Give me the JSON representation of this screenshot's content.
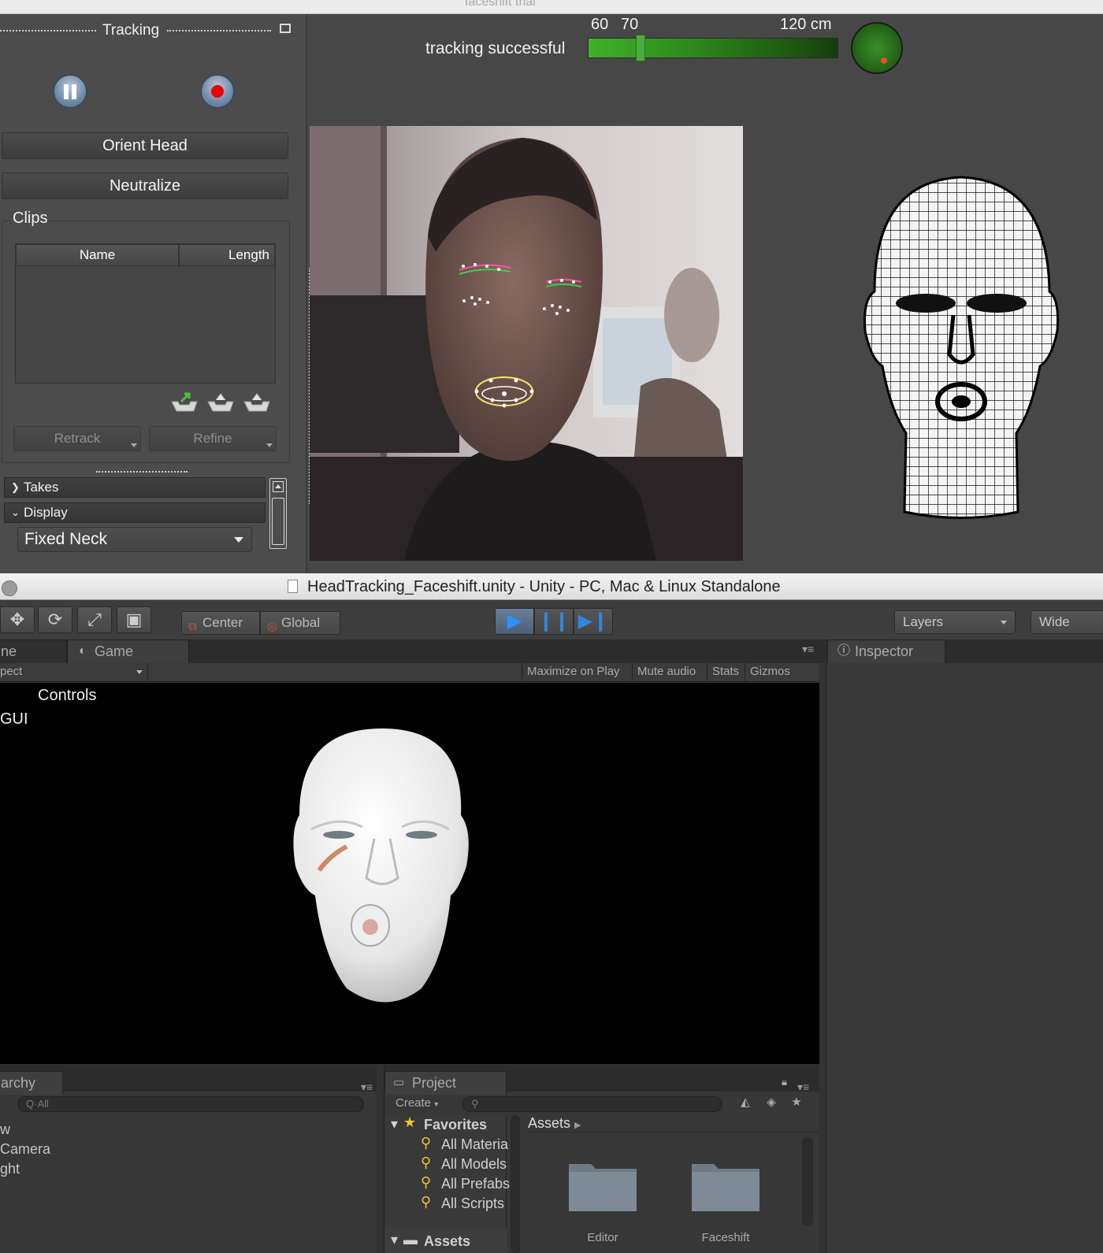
{
  "faceshift": {
    "window_title": "faceshift trial",
    "panel_title": "Tracking",
    "orient_head_label": "Orient Head",
    "neutralize_label": "Neutralize",
    "clips_label": "Clips",
    "clips_columns": [
      "Name",
      "Length"
    ],
    "retrack_label": "Retrack",
    "refine_label": "Refine",
    "takes_label": "Takes",
    "display_label": "Display",
    "neck_mode": "Fixed Neck",
    "status_text": "tracking successful",
    "distance_ticks": [
      "60",
      "70",
      "120 cm"
    ],
    "distance_level_fraction": 0.21,
    "radar_dot_color": "#e4521f",
    "accent_green": "#3fb12a"
  },
  "unity": {
    "window_title": "HeadTracking_Faceshift.unity - Unity - PC, Mac & Linux Standalone",
    "pivot_center": "Center",
    "pivot_global": "Global",
    "layers_label": "Layers",
    "layout_label": "Wide",
    "scene_tab_label": "ne",
    "game_tab_label": "Game",
    "aspect_label": "pect",
    "game_options": [
      "Maximize on Play",
      "Mute audio",
      "Stats",
      "Gizmos"
    ],
    "game_overlay": {
      "controls": "Controls",
      "gui": "GUI"
    },
    "inspector_tab_label": "Inspector",
    "hierarchy_tab_label": "archy",
    "hierarchy_search_placeholder": "Q·All",
    "hierarchy_items": [
      "w",
      "Camera",
      "ght"
    ],
    "project_tab_label": "Project",
    "create_label": "Create",
    "favorites_label": "Favorites",
    "favorites": [
      "All Materia",
      "All Models",
      "All Prefabs",
      "All Scripts"
    ],
    "assets_root_label": "Assets",
    "assets_breadcrumb": "Assets",
    "folders": [
      "Editor",
      "Faceshift"
    ],
    "play_accent": "#2d92ff"
  }
}
